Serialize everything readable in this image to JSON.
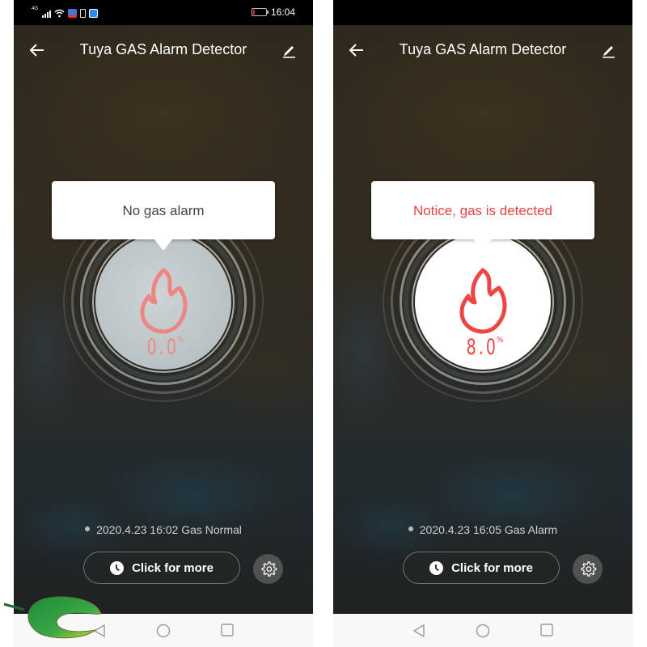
{
  "status_bar": {
    "network": "4G",
    "time": "16:04",
    "icons": [
      "signal-icon",
      "wifi-icon",
      "app-notification-icon",
      "battery-saver-icon",
      "app-notification-icon-2",
      "battery-low-icon"
    ]
  },
  "screens": [
    {
      "id": "normal",
      "app_bar": {
        "back_icon": "arrow-left-icon",
        "title": "Tuya GAS Alarm Detector",
        "edit_icon": "pencil-icon"
      },
      "tooltip": {
        "message": "No gas alarm",
        "color": "#444444"
      },
      "gauge": {
        "icon": "flame-icon",
        "value": "0.0",
        "unit": "%",
        "color": "#ee8585"
      },
      "last_event": "2020.4.23 16:02 Gas Normal",
      "more_button": {
        "label": "Click for more",
        "icon": "clock-icon"
      },
      "settings_button": {
        "icon": "gear-icon"
      }
    },
    {
      "id": "alarm",
      "app_bar": {
        "back_icon": "arrow-left-icon",
        "title": "Tuya GAS Alarm Detector",
        "edit_icon": "pencil-icon"
      },
      "tooltip": {
        "message": "Notice, gas is detected",
        "color": "#e84343"
      },
      "gauge": {
        "icon": "flame-icon",
        "value": "8.0",
        "unit": "%",
        "color": "#ef4444"
      },
      "last_event": "2020.4.23 16:05 Gas Alarm",
      "more_button": {
        "label": "Click for more",
        "icon": "clock-icon"
      },
      "settings_button": {
        "icon": "gear-icon"
      }
    }
  ],
  "system_nav": [
    "back",
    "home",
    "recents"
  ],
  "colors": {
    "accent_alarm": "#ef4444",
    "accent_normal": "#ee8585"
  }
}
